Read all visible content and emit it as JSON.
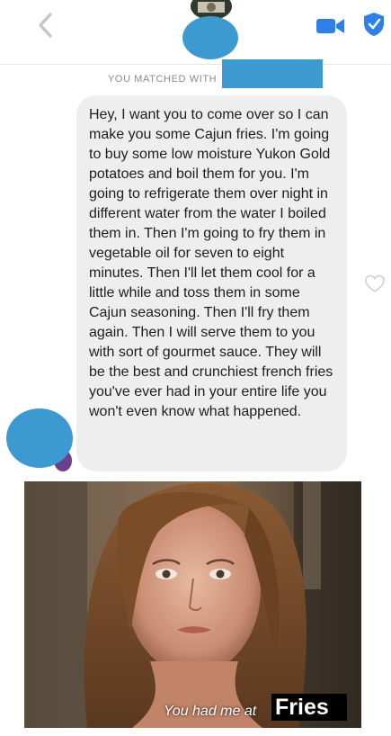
{
  "header": {
    "back_icon": "chevron-left-icon",
    "video_icon": "video-camera-icon",
    "shield_icon": "shield-icon",
    "accent_color": "#2f7fe8",
    "redaction_color": "#3d9ad1"
  },
  "match": {
    "label": "YOU MATCHED WITH"
  },
  "message": {
    "text": "Hey, I want you to come over so I can make you some Cajun fries. I'm going to buy some low moisture Yukon Gold potatoes and boil them for you. I'm going to refrigerate them over night in different water from the water I boiled them in. Then I'm going to fry them in vegetable oil for seven to eight minutes. Then I'll let them cool for a little while and toss them in some Cajun seasoning. Then I'll fry them again. Then I will serve them to you with sort of gourmet sauce. They will be the best and crunchiest french fries you've ever had in your entire life you won't even know what happened.",
    "like_icon": "heart-outline-icon"
  },
  "meme": {
    "caption_prefix": "You had me at",
    "caption_highlight": "Fries"
  }
}
